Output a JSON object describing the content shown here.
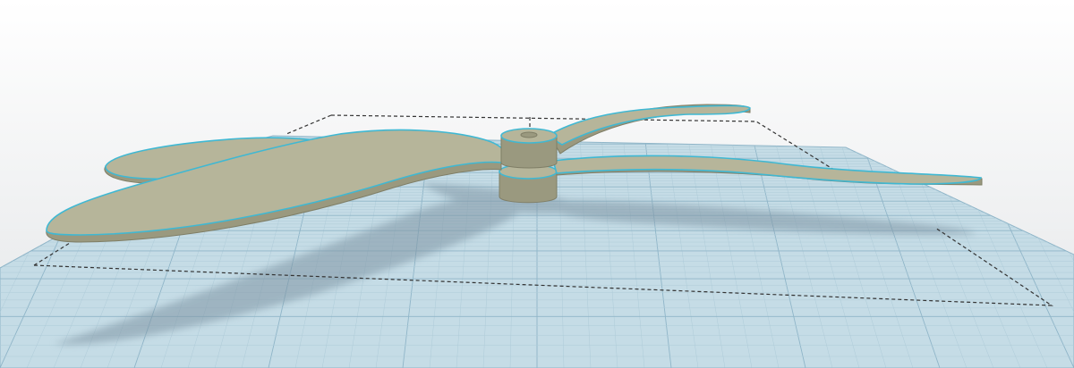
{
  "scene": {
    "description_free": true,
    "colors": {
      "background_top": "#ffffff",
      "background_bottom": "#e4e6e8",
      "workplane": "#c5dce6",
      "grid_minor": "#aecbd8",
      "grid_major": "#8fb5c8",
      "shadow": "#7f95a4",
      "part_face": "#b6b59a",
      "part_edge": "#7f7e66",
      "part_side": "#9a997f",
      "selection_outline": "#3fb8d3",
      "bounding_box": "#333333"
    },
    "objects": [
      {
        "name": "propeller",
        "selected": true,
        "icon": "propeller-model"
      }
    ]
  }
}
